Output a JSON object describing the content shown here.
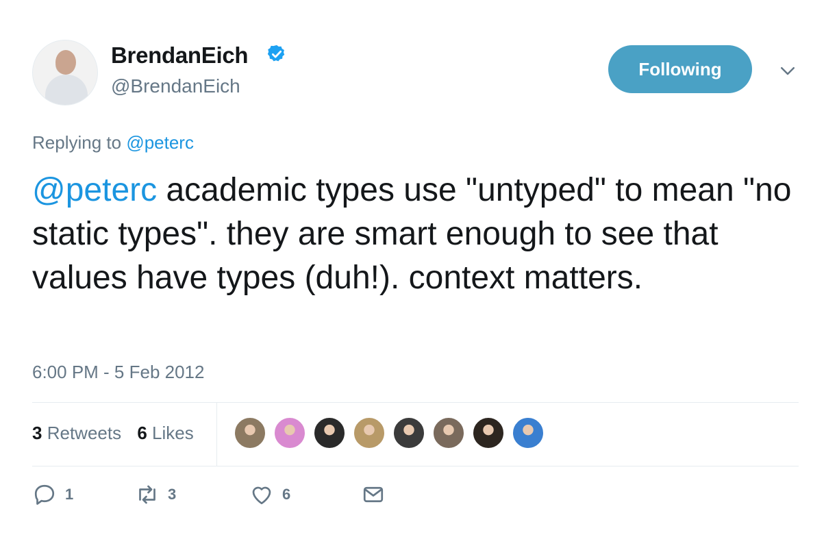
{
  "author": {
    "name": "BrendanEich",
    "handle": "@BrendanEich",
    "verified": true
  },
  "follow_button": {
    "label": "Following",
    "color": "#4aa1c5"
  },
  "reply_context": {
    "prefix": "Replying to",
    "mention": "@peterc"
  },
  "tweet": {
    "mention": "@peterc",
    "body": " academic types use \"untyped\" to mean \"no static types\". they are smart enough to see that values have types (duh!). context matters."
  },
  "timestamp": "6:00 PM - 5 Feb 2012",
  "stats": {
    "retweets_count": "3",
    "retweets_label": "Retweets",
    "likes_count": "6",
    "likes_label": "Likes"
  },
  "likers": [
    {
      "color": "#8c7a62"
    },
    {
      "color": "#d98ad0"
    },
    {
      "color": "#2a2a2a"
    },
    {
      "color": "#b89a68"
    },
    {
      "color": "#3b3b3b"
    },
    {
      "color": "#7a6a5c"
    },
    {
      "color": "#2d2620"
    },
    {
      "color": "#3a7fd0"
    }
  ],
  "actions": {
    "reply_count": "1",
    "retweet_count": "3",
    "like_count": "6"
  },
  "colors": {
    "link": "#1b95e0",
    "muted": "#657786",
    "verified": "#1da1f2"
  },
  "icons": [
    "verified-badge-icon",
    "chevron-down-icon",
    "reply-icon",
    "retweet-icon",
    "heart-icon",
    "mail-icon"
  ]
}
